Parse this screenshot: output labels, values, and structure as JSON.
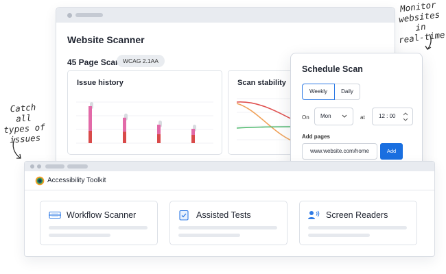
{
  "annotations": {
    "top_right": [
      "Monitor",
      "websites in",
      "real-time"
    ],
    "left": [
      "Catch all",
      "types of",
      "issues"
    ]
  },
  "scanner": {
    "title": "Website Scanner",
    "scan_label": "45 Page Scan",
    "badge": "WCAG 2.1AA",
    "issue_history": {
      "title": "Issue history",
      "chart_data": {
        "type": "bar",
        "series": [
          {
            "name": "",
            "color": "#e26aa8",
            "values": [
              0.9,
              0.62,
              0.45,
              0.35
            ]
          },
          {
            "name": "",
            "color": "#d94a4a",
            "values": [
              0.3,
              0.28,
              0.22,
              0.2
            ]
          }
        ]
      }
    },
    "scan_stability": {
      "title": "Scan stability",
      "chart_data": {
        "type": "line",
        "series": [
          {
            "name": "",
            "color": "#e0504f"
          },
          {
            "name": "",
            "color": "#f0a25a"
          },
          {
            "name": "",
            "color": "#4cb86b"
          }
        ]
      }
    }
  },
  "schedule": {
    "title": "Schedule Scan",
    "frequency_options": [
      "Weekly",
      "Daily"
    ],
    "selected_frequency": "Weekly",
    "on_label": "On",
    "day_value": "Mon",
    "at_label": "at",
    "time_value": "12 : 00",
    "add_pages_label": "Add pages",
    "url_value": "www.website.com/home",
    "add_button": "Add"
  },
  "toolkit": {
    "title": "Accessibility Toolkit",
    "cards": [
      {
        "label": "Workflow Scanner",
        "icon": "scanner-icon"
      },
      {
        "label": "Assisted Tests",
        "icon": "checklist-icon"
      },
      {
        "label": "Screen Readers",
        "icon": "speaker-icon"
      }
    ]
  },
  "colors": {
    "accent": "#1a6fe0",
    "pink": "#e26aa8",
    "red": "#d94a4a"
  }
}
